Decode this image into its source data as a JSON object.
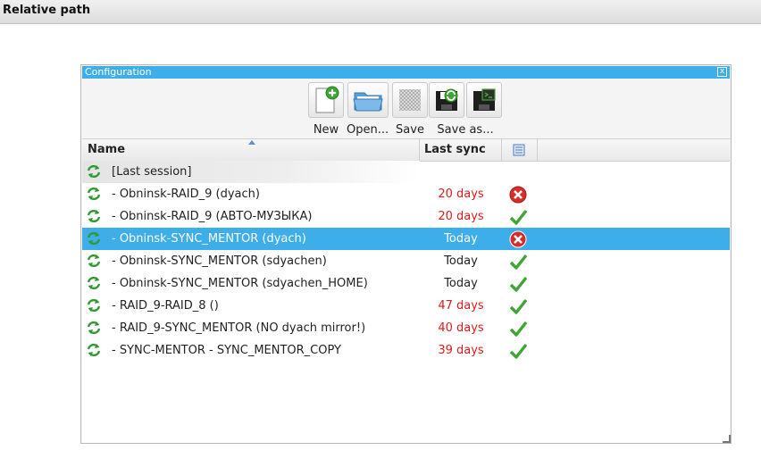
{
  "window": {
    "title": "Relative path"
  },
  "panel": {
    "title": "Configuration",
    "close_label": "x"
  },
  "toolbar": {
    "new_label": "New",
    "open_label": "Open...",
    "save_label": "Save",
    "save_as_label": "Save as..."
  },
  "list": {
    "columns": {
      "name": "Name",
      "last_sync": "Last sync"
    },
    "rows": [
      {
        "name": "[Last session]",
        "last_sync": "",
        "status": "none"
      },
      {
        "name": "- Obninsk-RAID_9 (dyach)",
        "last_sync": "20 days",
        "status": "error"
      },
      {
        "name": "- Obninsk-RAID_9 (АВТО-МУЗЫКА)",
        "last_sync": "20 days",
        "status": "ok"
      },
      {
        "name": "- Obninsk-SYNC_MENTOR (dyach)",
        "last_sync": "Today",
        "status": "error"
      },
      {
        "name": "- Obninsk-SYNC_MENTOR (sdyachen)",
        "last_sync": "Today",
        "status": "ok"
      },
      {
        "name": "- Obninsk-SYNC_MENTOR (sdyachen_HOME)",
        "last_sync": "Today",
        "status": "ok"
      },
      {
        "name": "- RAID_9-RAID_8 ()",
        "last_sync": "47 days",
        "status": "ok"
      },
      {
        "name": "- RAID_9-SYNC_MENTOR (NO dyach mirror!)",
        "last_sync": "40 days",
        "status": "ok"
      },
      {
        "name": "- SYNC-MENTOR - SYNC_MENTOR_COPY",
        "last_sync": "39 days",
        "status": "ok"
      }
    ]
  },
  "colors": {
    "accent": "#3daee9",
    "stale": "#e01b1b",
    "ok": "#3fa535",
    "error": "#d62c2c"
  }
}
